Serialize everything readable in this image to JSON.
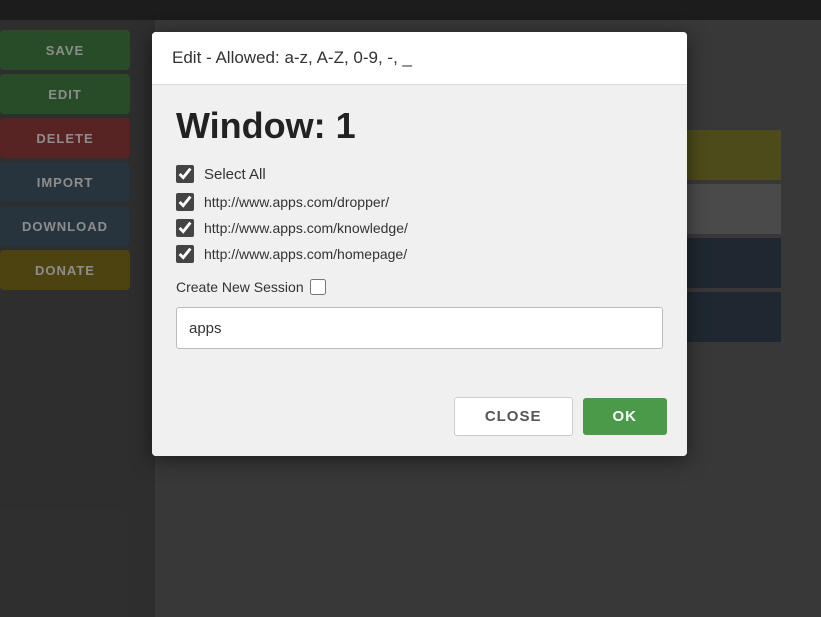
{
  "background": {
    "sidebar_buttons": [
      {
        "label": "SAVE",
        "color": "green"
      },
      {
        "label": "EDIT",
        "color": "green"
      },
      {
        "label": "DELETE",
        "color": "red"
      },
      {
        "label": "IMPORT",
        "color": "blue-gray"
      },
      {
        "label": "DOWNLOAD",
        "color": "blue-gray"
      },
      {
        "label": "DONATE",
        "color": "yellow"
      }
    ],
    "color_blocks": [
      "#8a8a30",
      "#888",
      "#3a4a5a",
      "#3a4a5a"
    ]
  },
  "dialog": {
    "header_text": "Edit - Allowed: a-z, A-Z, 0-9, -, _",
    "title": "Window: 1",
    "select_all_label": "Select All",
    "select_all_checked": true,
    "urls": [
      {
        "url": "http://www.apps.com/dropper/",
        "checked": true
      },
      {
        "url": "http://www.apps.com/knowledge/",
        "checked": true
      },
      {
        "url": "http://www.apps.com/homepage/",
        "checked": true
      }
    ],
    "create_session_label": "Create New Session",
    "create_session_checked": false,
    "input_value": "apps",
    "input_placeholder": "",
    "close_button": "CLOSE",
    "ok_button": "OK"
  }
}
